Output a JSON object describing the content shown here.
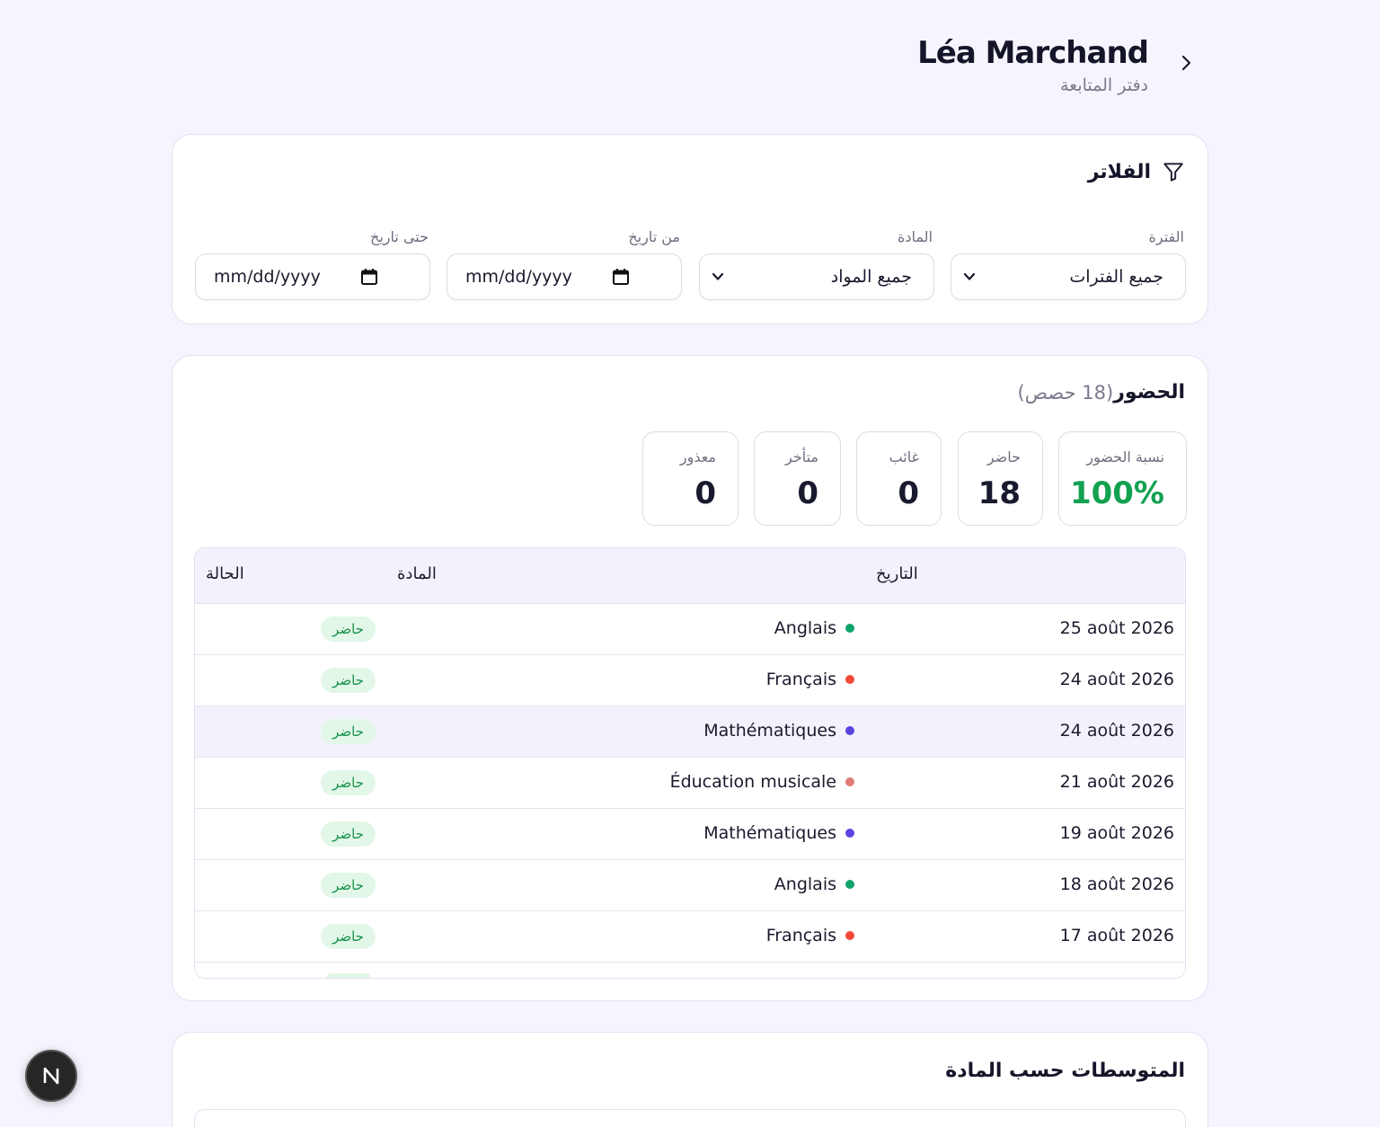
{
  "header": {
    "title": "Léa Marchand",
    "subtitle": "دفتر المتابعة"
  },
  "filters": {
    "heading": "الفلاتر",
    "period": {
      "label": "الفترة",
      "value": "جميع الفترات"
    },
    "subject": {
      "label": "المادة",
      "value": "جميع المواد"
    },
    "from_date": {
      "label": "من تاريخ",
      "value": "mm/dd/yyyy"
    },
    "to_date": {
      "label": "حتى تاريخ",
      "value": "mm/dd/yyyy"
    }
  },
  "attendance": {
    "heading": "الحضور",
    "count_text": "(18 حصص)",
    "stats": {
      "rate": {
        "label": "نسبة الحضور",
        "value": "100%"
      },
      "present": {
        "label": "حاضر",
        "value": "18"
      },
      "absent": {
        "label": "غائب",
        "value": "0"
      },
      "late": {
        "label": "متأخر",
        "value": "0"
      },
      "excused": {
        "label": "معذور",
        "value": "0"
      }
    },
    "columns": {
      "date": "التاريخ",
      "subject": "المادة",
      "status": "الحالة"
    },
    "rows": [
      {
        "date": "25 août 2026",
        "subject": "Anglais",
        "status": "حاضر",
        "color": "#10a36a"
      },
      {
        "date": "24 août 2026",
        "subject": "Français",
        "status": "حاضر",
        "color": "#f0493a"
      },
      {
        "date": "24 août 2026",
        "subject": "Mathématiques",
        "status": "حاضر",
        "color": "#5b45e0"
      },
      {
        "date": "21 août 2026",
        "subject": "Éducation musicale",
        "status": "حاضر",
        "color": "#e07a72"
      },
      {
        "date": "19 août 2026",
        "subject": "Mathématiques",
        "status": "حاضر",
        "color": "#5b45e0"
      },
      {
        "date": "18 août 2026",
        "subject": "Anglais",
        "status": "حاضر",
        "color": "#10a36a"
      },
      {
        "date": "17 août 2026",
        "subject": "Français",
        "status": "حاضر",
        "color": "#f0493a"
      }
    ]
  },
  "averages": {
    "heading": "المتوسطات حسب المادة"
  },
  "colors": {
    "accent_green": "#12a150",
    "badge_bg": "#e2f7e8",
    "background": "#f6f5fd"
  },
  "icons": {
    "back": "chevron-right-icon",
    "filter": "filter-icon",
    "select": "chevron-down-icon",
    "date": "calendar-icon",
    "dev": "nextjs-icon"
  }
}
